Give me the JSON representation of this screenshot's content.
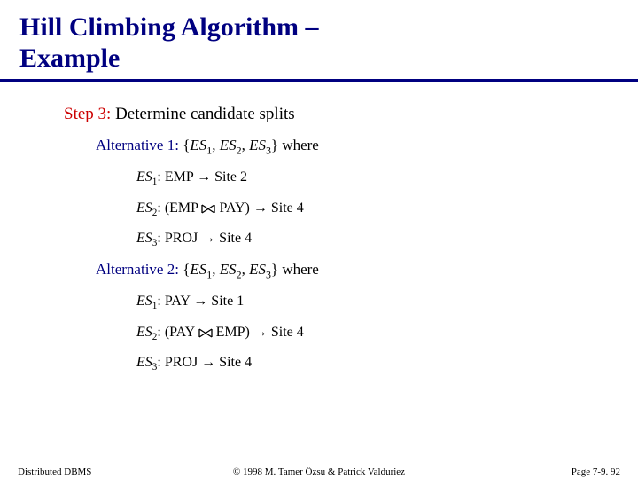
{
  "title_line1": "Hill Climbing Algorithm –",
  "title_line2": "Example",
  "step_label": "Step 3:",
  "step_text": " Determine candidate splits",
  "alt1_label": "Alternative 1:",
  "alt1_set_open": " {",
  "alt1_es1": "ES",
  "alt1_sub1": "1",
  "alt1_comma1": ", ",
  "alt1_es2": "ES",
  "alt1_sub2": "2",
  "alt1_comma2": ", ",
  "alt1_es3": "ES",
  "alt1_sub3": "3",
  "alt1_close": "} where",
  "a1_i1_es": "ES",
  "a1_i1_sub": "1",
  "a1_i1_body": ": EMP → Site 2",
  "a1_i2_es": "ES",
  "a1_i2_sub": "2",
  "a1_i2_pre": ": (EMP ",
  "a1_i2_post": " PAY) → Site 4",
  "a1_i3_es": "ES",
  "a1_i3_sub": "3",
  "a1_i3_body": ": PROJ → Site 4",
  "alt2_label": "Alternative 2:",
  "alt2_set_open": " {",
  "alt2_es1": "ES",
  "alt2_sub1": "1",
  "alt2_comma1": ", ",
  "alt2_es2": "ES",
  "alt2_sub2": "2",
  "alt2_comma2": ", ",
  "alt2_es3": "ES",
  "alt2_sub3": "3",
  "alt2_close": "} where",
  "a2_i1_es": "ES",
  "a2_i1_sub": "1",
  "a2_i1_body": ": PAY → Site 1",
  "a2_i2_es": "ES",
  "a2_i2_sub": "2",
  "a2_i2_pre": ": (PAY ",
  "a2_i2_post": " EMP) → Site 4",
  "a2_i3_es": "ES",
  "a2_i3_sub": "3",
  "a2_i3_body": ": PROJ → Site 4",
  "footer_left": "Distributed DBMS",
  "footer_center": "© 1998 M. Tamer Özsu & Patrick Valduriez",
  "footer_right": "Page 7-9. 92"
}
